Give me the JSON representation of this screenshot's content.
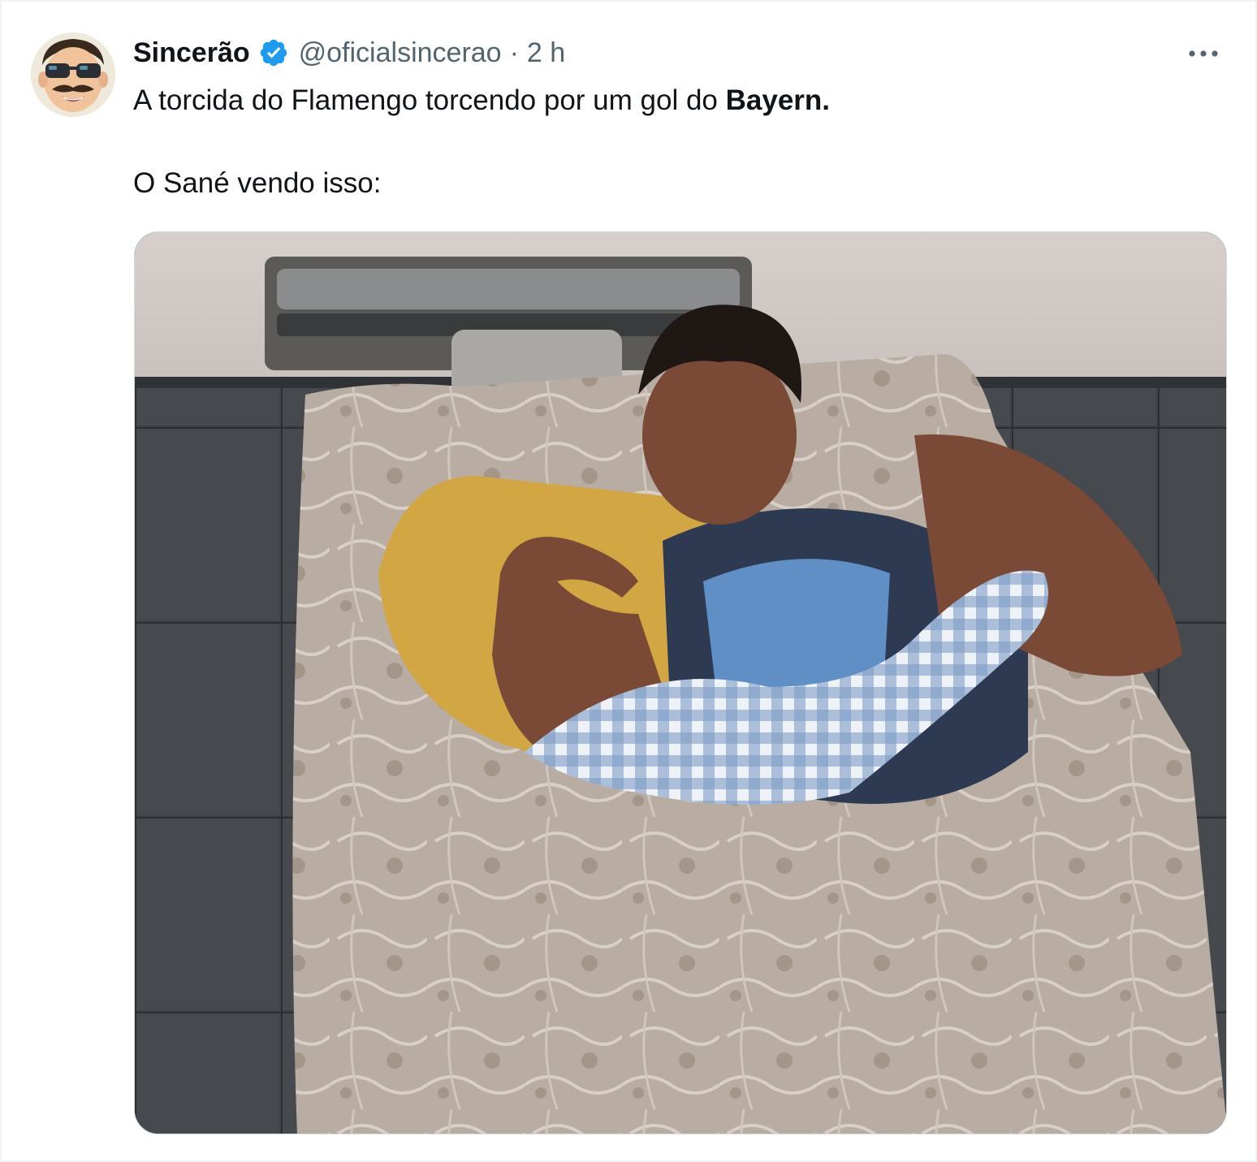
{
  "tweet": {
    "display_name": "Sincerão",
    "handle": "@oficialsincerao",
    "separator": "·",
    "time": "2 h",
    "text_line1_prefix": "A torcida do Flamengo torcendo por um gol do ",
    "text_line1_bold": "Bayern.",
    "text_line2": "O Sané vendo isso:"
  },
  "icons": {
    "avatar": "cartoon-face-sunglasses-mustache",
    "verified": "verified-badge-icon",
    "more": "more-options-icon"
  },
  "colors": {
    "text_primary": "#0f1419",
    "text_secondary": "#536471",
    "verified_blue": "#1d9bf0",
    "border": "#cfd9de"
  }
}
